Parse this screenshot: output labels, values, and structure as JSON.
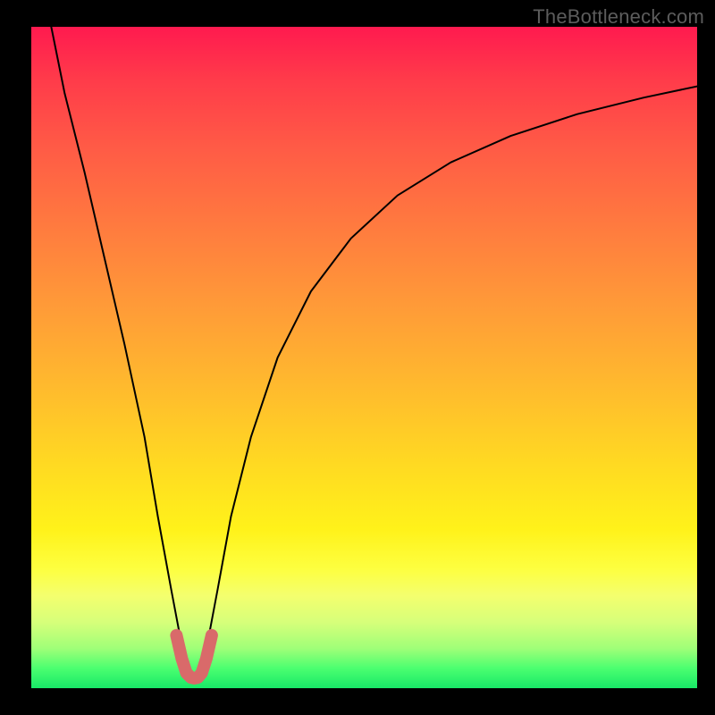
{
  "watermark": "TheBottleneck.com",
  "chart_data": {
    "type": "line",
    "title": "",
    "xlabel": "",
    "ylabel": "",
    "xlim": [
      0,
      100
    ],
    "ylim": [
      0,
      100
    ],
    "series": [
      {
        "name": "bottleneck-curve",
        "x": [
          3,
          5,
          8,
          11,
          14,
          17,
          19,
          21,
          22.5,
          23.5,
          24.5,
          25.5,
          26.5,
          28,
          30,
          33,
          37,
          42,
          48,
          55,
          63,
          72,
          82,
          92,
          100
        ],
        "y": [
          100,
          90,
          78,
          65,
          52,
          38,
          26,
          15,
          7,
          3,
          1.5,
          3,
          7,
          15,
          26,
          38,
          50,
          60,
          68,
          74.5,
          79.5,
          83.5,
          86.8,
          89.3,
          91
        ]
      }
    ],
    "highlight": {
      "name": "minimum-region",
      "color": "#d96a6a",
      "x": [
        21.8,
        22.6,
        23.3,
        24.0,
        24.5,
        25.0,
        25.6,
        26.3,
        27.1
      ],
      "y": [
        8.0,
        4.5,
        2.3,
        1.6,
        1.5,
        1.6,
        2.3,
        4.5,
        8.0
      ]
    }
  }
}
